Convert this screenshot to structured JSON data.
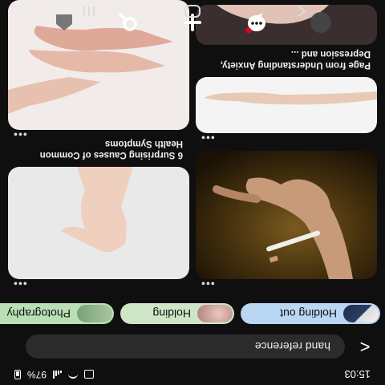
{
  "status": {
    "time": "15:03",
    "battery": "97%"
  },
  "search": {
    "query": "hand reference",
    "back_glyph": "<"
  },
  "chips": [
    {
      "label": "Holding out"
    },
    {
      "label": "Holding"
    },
    {
      "label": "Photography"
    }
  ],
  "pins": {
    "left": [
      {
        "caption": "",
        "kind": "cigarette-hand"
      },
      {
        "caption": "",
        "kind": "reaching-hand"
      },
      {
        "caption": "Page from Understanding Anxiety, Depression and ...",
        "kind": "dark-arm"
      }
    ],
    "right": [
      {
        "caption": "",
        "kind": "open-hand"
      },
      {
        "caption": "6 Surprising Causes of Common Health Symptoms",
        "kind": "two-hands"
      }
    ]
  },
  "more_glyph": "•••",
  "nav": [
    "profile-icon",
    "chat-icon",
    "add-icon",
    "search-icon",
    "home-icon"
  ],
  "colors": {
    "background": "#0f0f0f",
    "notification": "#e60023"
  }
}
